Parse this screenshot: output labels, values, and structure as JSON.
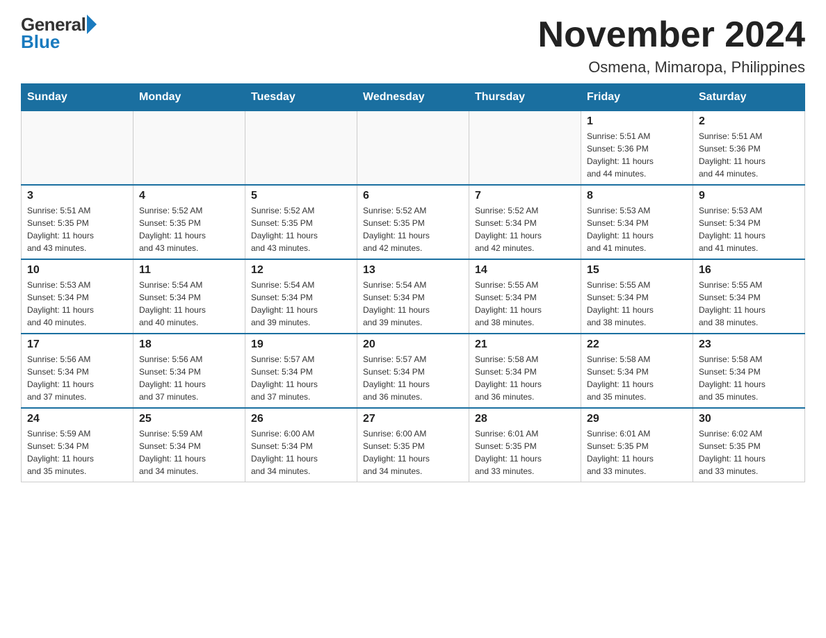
{
  "logo": {
    "general": "General",
    "blue": "Blue"
  },
  "header": {
    "month": "November 2024",
    "location": "Osmena, Mimaropa, Philippines"
  },
  "days_of_week": [
    "Sunday",
    "Monday",
    "Tuesday",
    "Wednesday",
    "Thursday",
    "Friday",
    "Saturday"
  ],
  "weeks": [
    [
      {
        "day": "",
        "info": ""
      },
      {
        "day": "",
        "info": ""
      },
      {
        "day": "",
        "info": ""
      },
      {
        "day": "",
        "info": ""
      },
      {
        "day": "",
        "info": ""
      },
      {
        "day": "1",
        "info": "Sunrise: 5:51 AM\nSunset: 5:36 PM\nDaylight: 11 hours\nand 44 minutes."
      },
      {
        "day": "2",
        "info": "Sunrise: 5:51 AM\nSunset: 5:36 PM\nDaylight: 11 hours\nand 44 minutes."
      }
    ],
    [
      {
        "day": "3",
        "info": "Sunrise: 5:51 AM\nSunset: 5:35 PM\nDaylight: 11 hours\nand 43 minutes."
      },
      {
        "day": "4",
        "info": "Sunrise: 5:52 AM\nSunset: 5:35 PM\nDaylight: 11 hours\nand 43 minutes."
      },
      {
        "day": "5",
        "info": "Sunrise: 5:52 AM\nSunset: 5:35 PM\nDaylight: 11 hours\nand 43 minutes."
      },
      {
        "day": "6",
        "info": "Sunrise: 5:52 AM\nSunset: 5:35 PM\nDaylight: 11 hours\nand 42 minutes."
      },
      {
        "day": "7",
        "info": "Sunrise: 5:52 AM\nSunset: 5:34 PM\nDaylight: 11 hours\nand 42 minutes."
      },
      {
        "day": "8",
        "info": "Sunrise: 5:53 AM\nSunset: 5:34 PM\nDaylight: 11 hours\nand 41 minutes."
      },
      {
        "day": "9",
        "info": "Sunrise: 5:53 AM\nSunset: 5:34 PM\nDaylight: 11 hours\nand 41 minutes."
      }
    ],
    [
      {
        "day": "10",
        "info": "Sunrise: 5:53 AM\nSunset: 5:34 PM\nDaylight: 11 hours\nand 40 minutes."
      },
      {
        "day": "11",
        "info": "Sunrise: 5:54 AM\nSunset: 5:34 PM\nDaylight: 11 hours\nand 40 minutes."
      },
      {
        "day": "12",
        "info": "Sunrise: 5:54 AM\nSunset: 5:34 PM\nDaylight: 11 hours\nand 39 minutes."
      },
      {
        "day": "13",
        "info": "Sunrise: 5:54 AM\nSunset: 5:34 PM\nDaylight: 11 hours\nand 39 minutes."
      },
      {
        "day": "14",
        "info": "Sunrise: 5:55 AM\nSunset: 5:34 PM\nDaylight: 11 hours\nand 38 minutes."
      },
      {
        "day": "15",
        "info": "Sunrise: 5:55 AM\nSunset: 5:34 PM\nDaylight: 11 hours\nand 38 minutes."
      },
      {
        "day": "16",
        "info": "Sunrise: 5:55 AM\nSunset: 5:34 PM\nDaylight: 11 hours\nand 38 minutes."
      }
    ],
    [
      {
        "day": "17",
        "info": "Sunrise: 5:56 AM\nSunset: 5:34 PM\nDaylight: 11 hours\nand 37 minutes."
      },
      {
        "day": "18",
        "info": "Sunrise: 5:56 AM\nSunset: 5:34 PM\nDaylight: 11 hours\nand 37 minutes."
      },
      {
        "day": "19",
        "info": "Sunrise: 5:57 AM\nSunset: 5:34 PM\nDaylight: 11 hours\nand 37 minutes."
      },
      {
        "day": "20",
        "info": "Sunrise: 5:57 AM\nSunset: 5:34 PM\nDaylight: 11 hours\nand 36 minutes."
      },
      {
        "day": "21",
        "info": "Sunrise: 5:58 AM\nSunset: 5:34 PM\nDaylight: 11 hours\nand 36 minutes."
      },
      {
        "day": "22",
        "info": "Sunrise: 5:58 AM\nSunset: 5:34 PM\nDaylight: 11 hours\nand 35 minutes."
      },
      {
        "day": "23",
        "info": "Sunrise: 5:58 AM\nSunset: 5:34 PM\nDaylight: 11 hours\nand 35 minutes."
      }
    ],
    [
      {
        "day": "24",
        "info": "Sunrise: 5:59 AM\nSunset: 5:34 PM\nDaylight: 11 hours\nand 35 minutes."
      },
      {
        "day": "25",
        "info": "Sunrise: 5:59 AM\nSunset: 5:34 PM\nDaylight: 11 hours\nand 34 minutes."
      },
      {
        "day": "26",
        "info": "Sunrise: 6:00 AM\nSunset: 5:34 PM\nDaylight: 11 hours\nand 34 minutes."
      },
      {
        "day": "27",
        "info": "Sunrise: 6:00 AM\nSunset: 5:35 PM\nDaylight: 11 hours\nand 34 minutes."
      },
      {
        "day": "28",
        "info": "Sunrise: 6:01 AM\nSunset: 5:35 PM\nDaylight: 11 hours\nand 33 minutes."
      },
      {
        "day": "29",
        "info": "Sunrise: 6:01 AM\nSunset: 5:35 PM\nDaylight: 11 hours\nand 33 minutes."
      },
      {
        "day": "30",
        "info": "Sunrise: 6:02 AM\nSunset: 5:35 PM\nDaylight: 11 hours\nand 33 minutes."
      }
    ]
  ]
}
